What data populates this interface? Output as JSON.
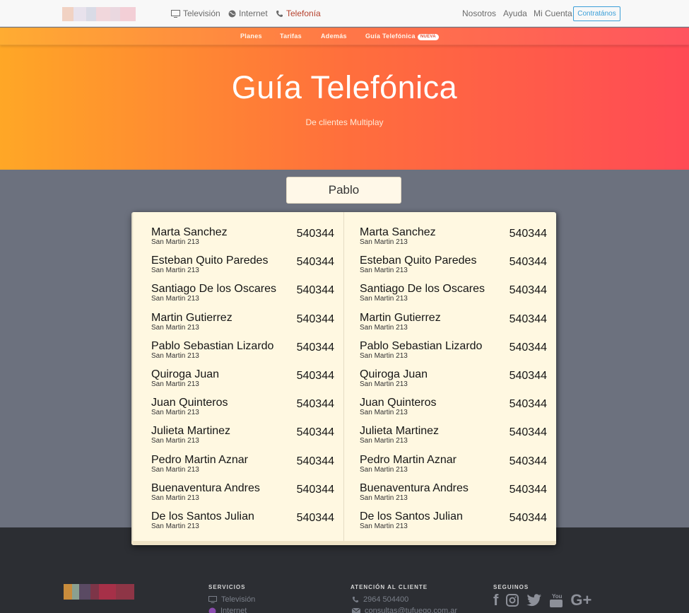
{
  "nav": {
    "links": [
      {
        "label": "Televisión",
        "icon": "tv-icon"
      },
      {
        "label": "Internet",
        "icon": "globe-icon"
      },
      {
        "label": "Telefonía",
        "icon": "phone-icon",
        "active": true
      }
    ],
    "right_links": [
      "Nosotros",
      "Ayuda",
      "Mi Cuenta"
    ],
    "cta_label": "Contratános"
  },
  "subnav": {
    "items": [
      "Planes",
      "Tarifas",
      "Además",
      "Guía Telefónica"
    ],
    "badge": "NUEVA"
  },
  "hero": {
    "title": "Guía Telefónica",
    "subtitle": "De clientes Multiplay"
  },
  "search": {
    "value": "Pablo"
  },
  "directory": {
    "left": [
      {
        "name": "Marta Sanchez",
        "address": "San Martin 213",
        "phone": "540344"
      },
      {
        "name": "Esteban Quito Paredes",
        "address": "San Martin 213",
        "phone": "540344"
      },
      {
        "name": "Santiago De los Oscares",
        "address": "San Martin 213",
        "phone": "540344"
      },
      {
        "name": "Martin Gutierrez",
        "address": "San Martin 213",
        "phone": "540344"
      },
      {
        "name": "Pablo Sebastian Lizardo",
        "address": "San Martin 213",
        "phone": "540344"
      },
      {
        "name": "Quiroga Juan",
        "address": "San Martin 213",
        "phone": "540344"
      },
      {
        "name": "Juan Quinteros",
        "address": "San Martin 213",
        "phone": "540344"
      },
      {
        "name": "Julieta Martinez",
        "address": "San Martin 213",
        "phone": "540344"
      },
      {
        "name": "Pedro Martin Aznar",
        "address": "San Martin 213",
        "phone": "540344"
      },
      {
        "name": "Buenaventura Andres",
        "address": "San Martin 213",
        "phone": "540344"
      },
      {
        "name": "De los Santos Julian",
        "address": "San Martin 213",
        "phone": "540344"
      }
    ],
    "right": [
      {
        "name": "Marta Sanchez",
        "address": "San Martin 213",
        "phone": "540344"
      },
      {
        "name": "Esteban Quito Paredes",
        "address": "San Martin 213",
        "phone": "540344"
      },
      {
        "name": "Santiago De los Oscares",
        "address": "San Martin 213",
        "phone": "540344"
      },
      {
        "name": "Martin Gutierrez",
        "address": "San Martin 213",
        "phone": "540344"
      },
      {
        "name": "Pablo Sebastian Lizardo",
        "address": "San Martin 213",
        "phone": "540344"
      },
      {
        "name": "Quiroga Juan",
        "address": "San Martin 213",
        "phone": "540344"
      },
      {
        "name": "Juan Quinteros",
        "address": "San Martin 213",
        "phone": "540344"
      },
      {
        "name": "Julieta Martinez",
        "address": "San Martin 213",
        "phone": "540344"
      },
      {
        "name": "Pedro Martin Aznar",
        "address": "San Martin 213",
        "phone": "540344"
      },
      {
        "name": "Buenaventura Andres",
        "address": "San Martin 213",
        "phone": "540344"
      },
      {
        "name": "De los Santos Julian",
        "address": "San Martin 213",
        "phone": "540344"
      }
    ]
  },
  "footer": {
    "servicios": {
      "heading": "SERVICIOS",
      "items": [
        "Televisión",
        "Internet"
      ]
    },
    "atencion": {
      "heading": "ATENCIÓN AL CLIENTE",
      "phone": "2964 504400",
      "email": "consultas@tufuego.com.ar"
    },
    "seguinos": {
      "heading": "SEGUINOS",
      "networks": [
        "facebook-icon",
        "instagram-icon",
        "twitter-icon",
        "youtube-icon",
        "google-plus-icon"
      ]
    }
  },
  "colors": {
    "accent_active": "#b5402c",
    "cta": "#3b9fd8",
    "hero_gradient_start": "#ffa726",
    "hero_gradient_end": "#ff4a55",
    "page_bg": "#6c717e",
    "footer_bg": "#2c2e33",
    "book_paper": "#fff8e1"
  }
}
